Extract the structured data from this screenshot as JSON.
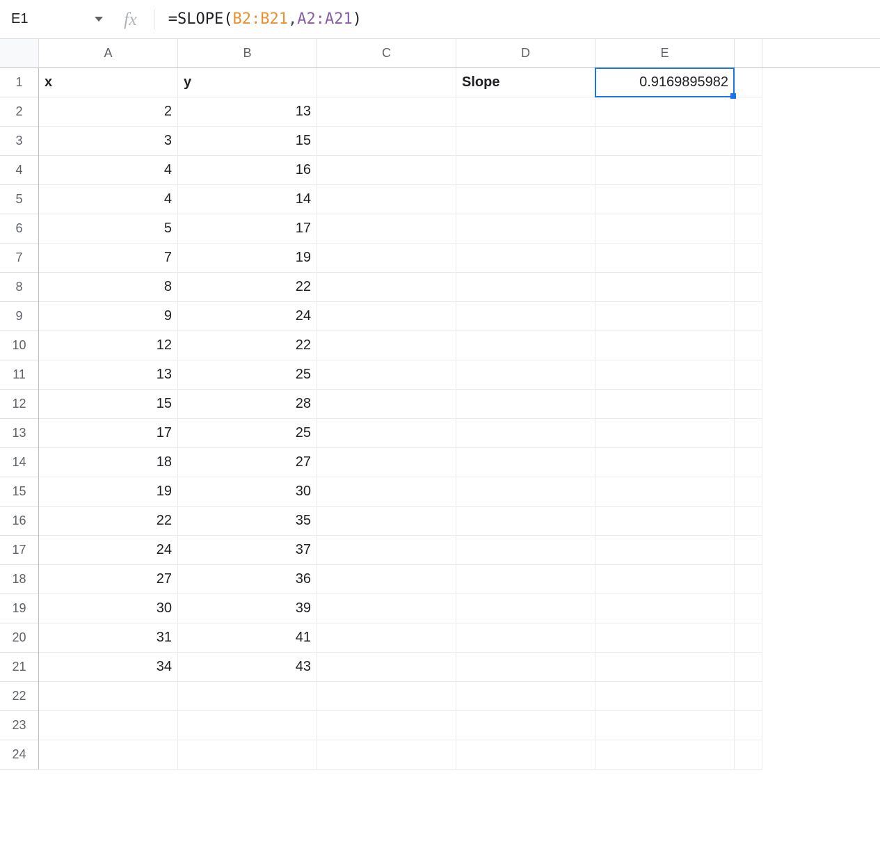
{
  "formula_bar": {
    "name_box": "E1",
    "formula": {
      "prefix": "=SLOPE",
      "open": "(",
      "range1": "B2:B21",
      "comma": ", ",
      "range2": "A2:A21",
      "close": ")"
    }
  },
  "columns": [
    "A",
    "B",
    "C",
    "D",
    "E"
  ],
  "row_count": 24,
  "col_widths": {
    "A": 200,
    "B": 200,
    "C": 200,
    "D": 200,
    "E": 200,
    "F": 40
  },
  "header_row": {
    "A": "x",
    "B": "y",
    "D": "Slope",
    "E": "0.9169895982"
  },
  "data": [
    {
      "x": "2",
      "y": "13"
    },
    {
      "x": "3",
      "y": "15"
    },
    {
      "x": "4",
      "y": "16"
    },
    {
      "x": "4",
      "y": "14"
    },
    {
      "x": "5",
      "y": "17"
    },
    {
      "x": "7",
      "y": "19"
    },
    {
      "x": "8",
      "y": "22"
    },
    {
      "x": "9",
      "y": "24"
    },
    {
      "x": "12",
      "y": "22"
    },
    {
      "x": "13",
      "y": "25"
    },
    {
      "x": "15",
      "y": "28"
    },
    {
      "x": "17",
      "y": "25"
    },
    {
      "x": "18",
      "y": "27"
    },
    {
      "x": "19",
      "y": "30"
    },
    {
      "x": "22",
      "y": "35"
    },
    {
      "x": "24",
      "y": "37"
    },
    {
      "x": "27",
      "y": "36"
    },
    {
      "x": "30",
      "y": "39"
    },
    {
      "x": "31",
      "y": "41"
    },
    {
      "x": "34",
      "y": "43"
    }
  ],
  "selected_cell": {
    "col": "E",
    "row": 1
  }
}
